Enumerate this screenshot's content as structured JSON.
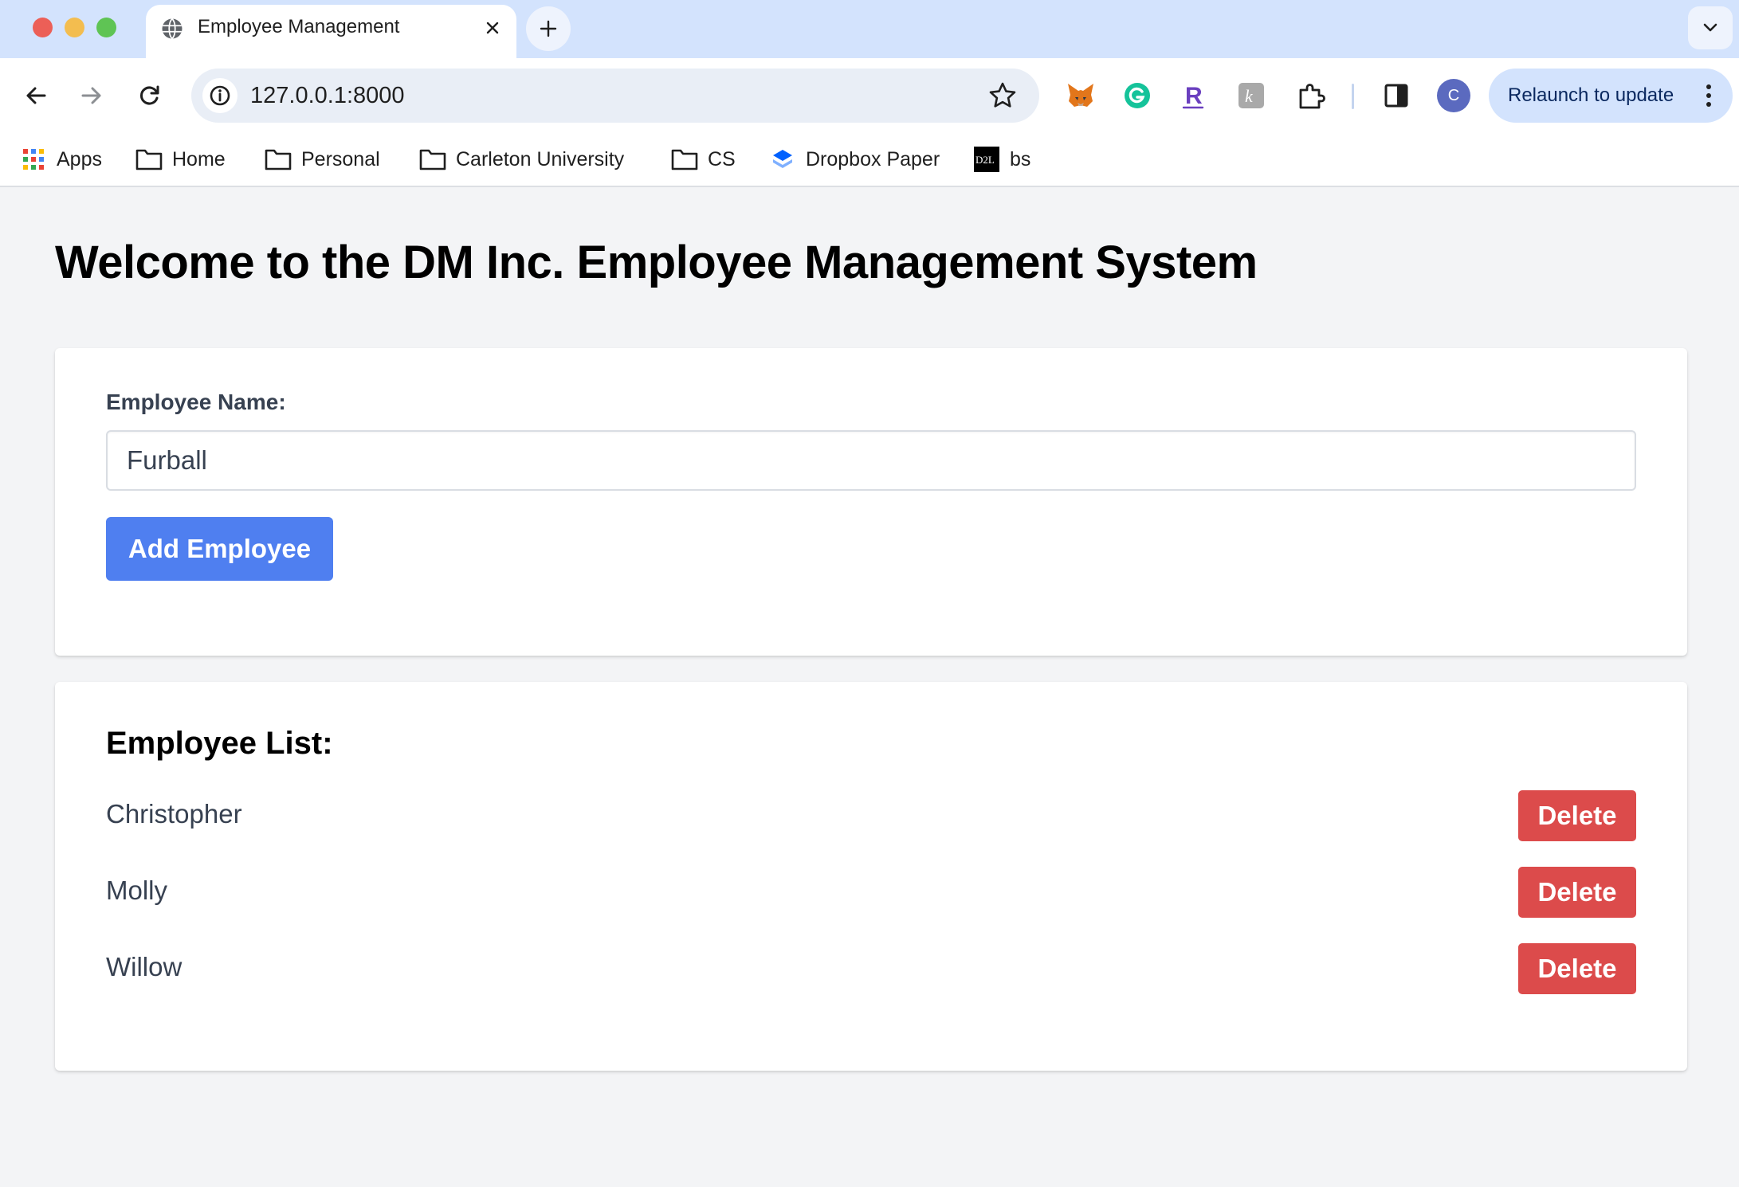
{
  "browser": {
    "tab_title": "Employee Management",
    "url": "127.0.0.1:8000",
    "relaunch_label": "Relaunch to update",
    "avatar_initial": "C",
    "bookmarks": [
      {
        "label": "Apps",
        "icon": "apps-grid-icon"
      },
      {
        "label": "Home",
        "icon": "folder-icon"
      },
      {
        "label": "Personal",
        "icon": "folder-icon"
      },
      {
        "label": "Carleton University",
        "icon": "folder-icon"
      },
      {
        "label": "CS",
        "icon": "folder-icon"
      },
      {
        "label": "Dropbox Paper",
        "icon": "dropbox-icon"
      },
      {
        "label": "bs",
        "icon": "d2l-icon"
      }
    ],
    "extensions": [
      "metamask-icon",
      "grammarly-icon",
      "r-extension-icon",
      "k-extension-icon",
      "puzzle-icon",
      "side-panel-icon"
    ],
    "colors": {
      "tabstrip": "#d3e3fd",
      "omnibox": "#e9eef6"
    }
  },
  "page": {
    "title": "Welcome to the DM Inc. Employee Management System",
    "form": {
      "label": "Employee Name:",
      "input_value": "Furball",
      "add_button": "Add Employee"
    },
    "list": {
      "title": "Employee List:",
      "delete_label": "Delete",
      "employees": [
        "Christopher",
        "Molly",
        "Willow"
      ]
    },
    "colors": {
      "primary": "#4f7ff0",
      "danger": "#dc4b4b",
      "background": "#f3f4f6"
    }
  }
}
